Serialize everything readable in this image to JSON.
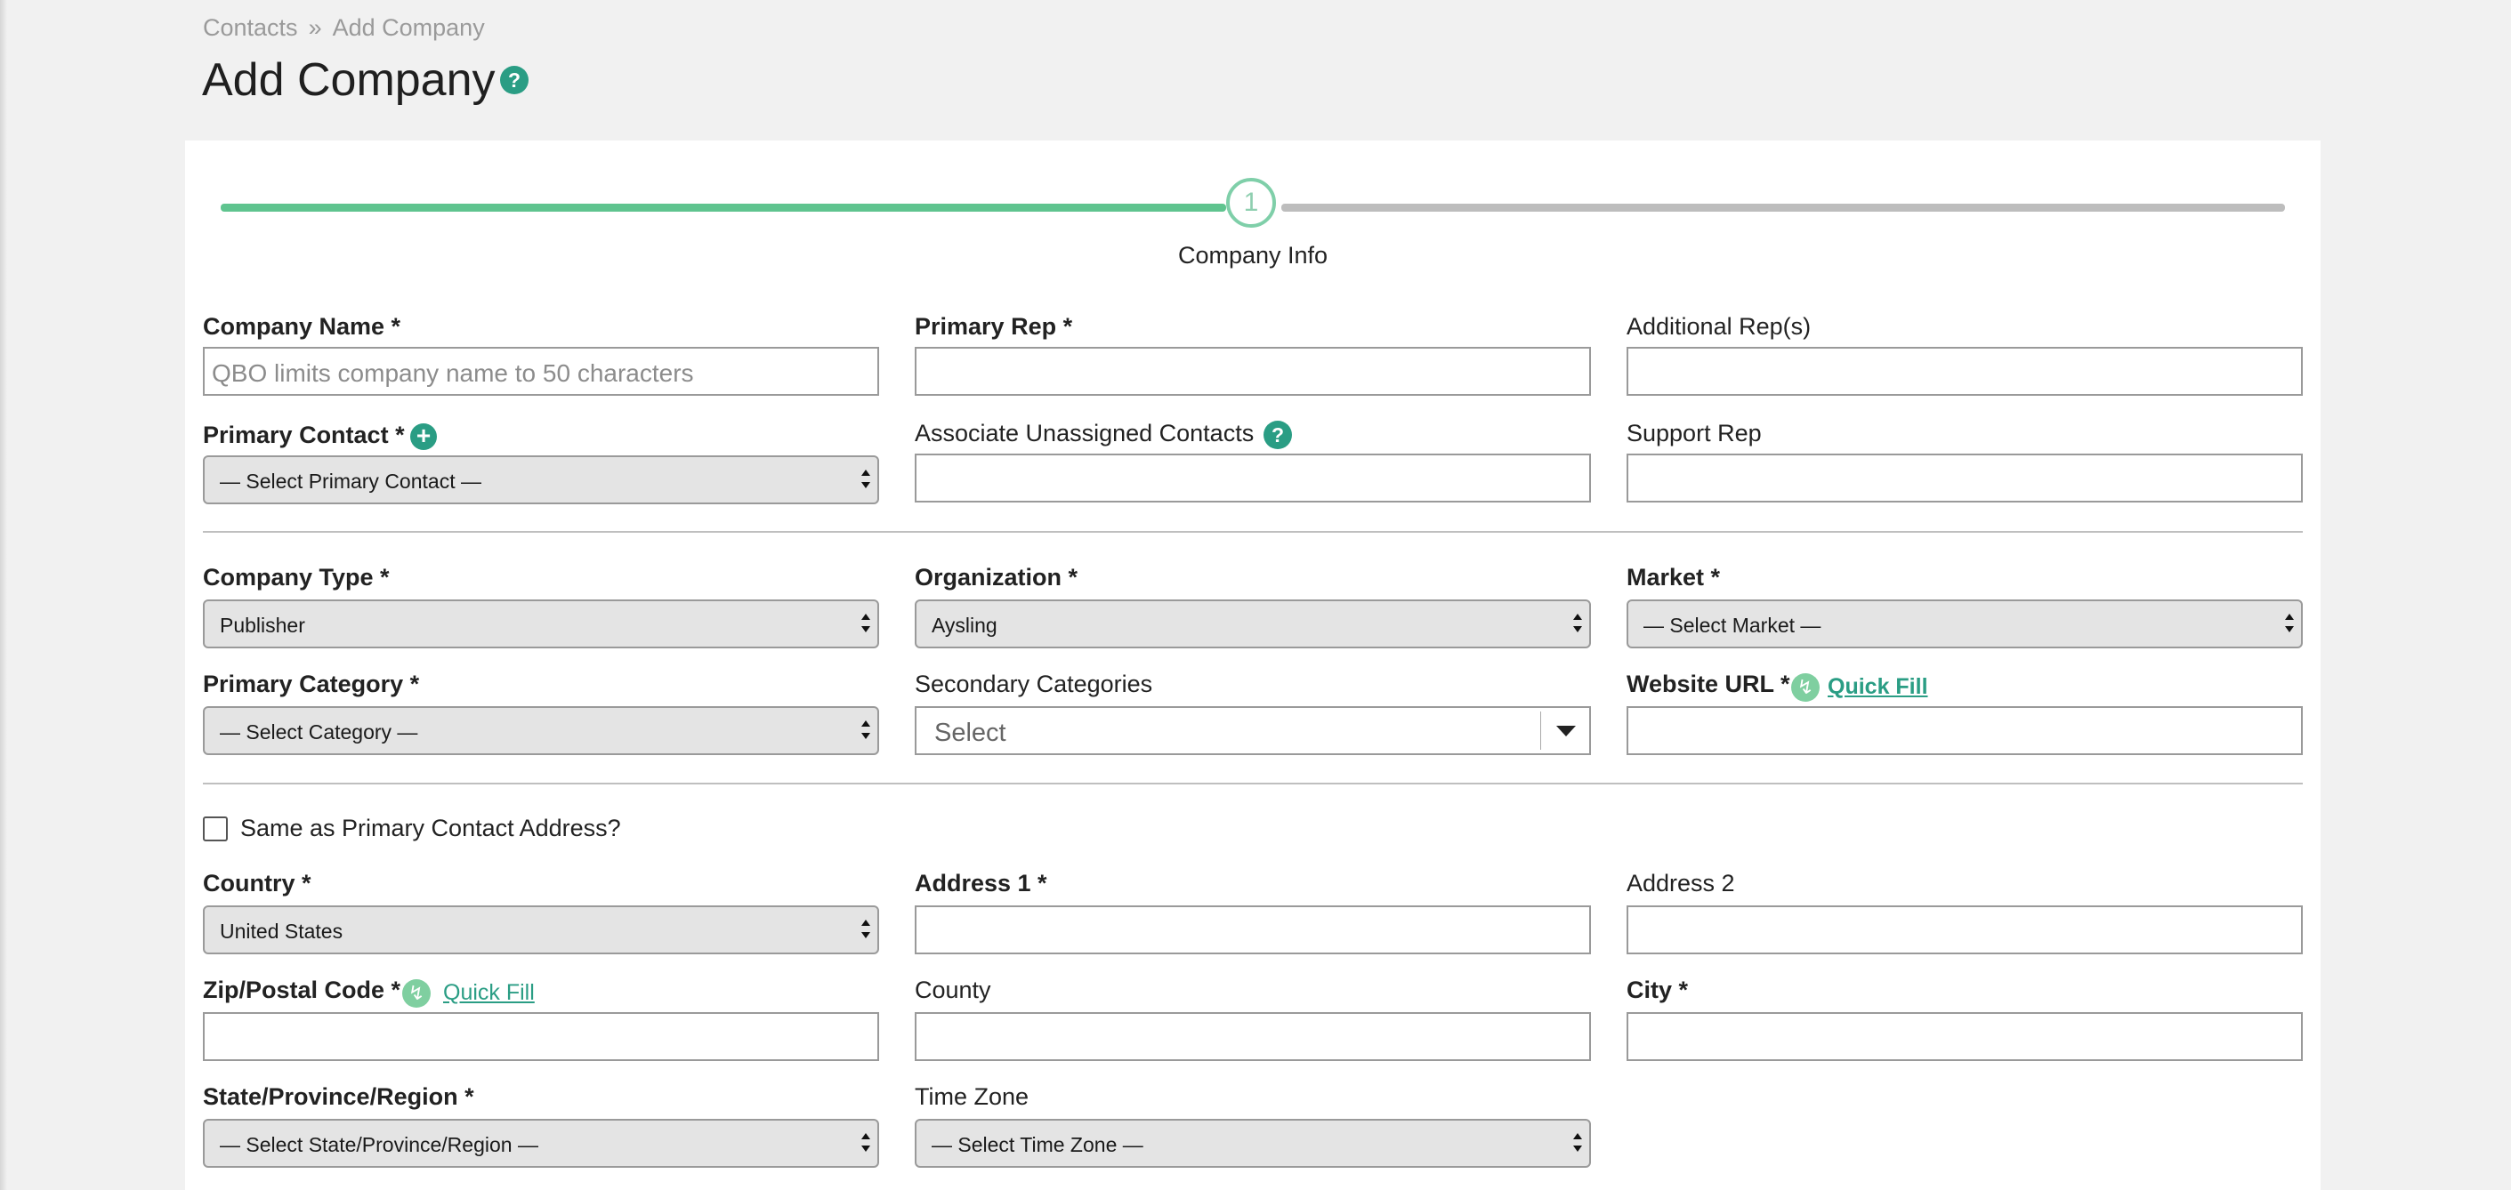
{
  "breadcrumb": {
    "contacts": "Contacts",
    "separator": "»",
    "current": "Add Company"
  },
  "page": {
    "title": "Add Company",
    "help_glyph": "?"
  },
  "stepper": {
    "step_number": "1",
    "step_label": "Company Info",
    "progress_percent": 50
  },
  "colors": {
    "accent": "#2a9d84",
    "progress": "#5fc48f",
    "quick_fill": "#7fcfa0"
  },
  "icons": {
    "help": "help-icon",
    "add": "plus-circle-icon",
    "quick_fill": "bolt-icon",
    "dropdown": "caret-down-icon"
  },
  "form": {
    "company_name": {
      "label": "Company Name *",
      "placeholder": "QBO limits company name to 50 characters"
    },
    "primary_rep": {
      "label": "Primary Rep *"
    },
    "additional_reps": {
      "label": "Additional Rep(s)"
    },
    "primary_contact": {
      "label": "Primary Contact *",
      "value": "— Select Primary Contact —",
      "add_glyph": "+"
    },
    "associate_unassigned": {
      "label": "Associate Unassigned Contacts",
      "help_glyph": "?"
    },
    "support_rep": {
      "label": "Support Rep"
    },
    "company_type": {
      "label": "Company Type *",
      "value": "Publisher"
    },
    "organization": {
      "label": "Organization *",
      "value": "Aysling"
    },
    "market": {
      "label": "Market *",
      "value": "— Select Market —"
    },
    "primary_category": {
      "label": "Primary Category *",
      "value": "— Select Category —"
    },
    "secondary_categories": {
      "label": "Secondary Categories",
      "value": "Select"
    },
    "website_url": {
      "label": "Website URL *",
      "quick_fill": "Quick Fill",
      "bolt_glyph": "↯"
    },
    "same_as_contact": {
      "label": "Same as Primary Contact Address?",
      "checked": false
    },
    "country": {
      "label": "Country *",
      "value": "United States"
    },
    "address1": {
      "label": "Address 1 *"
    },
    "address2": {
      "label": "Address 2"
    },
    "zip": {
      "label": "Zip/Postal Code *",
      "quick_fill": "Quick Fill",
      "bolt_glyph": "↯"
    },
    "county": {
      "label": "County"
    },
    "city": {
      "label": "City *"
    },
    "state": {
      "label": "State/Province/Region *",
      "value": "— Select State/Province/Region —"
    },
    "time_zone": {
      "label": "Time Zone",
      "value": "— Select Time Zone —"
    }
  }
}
